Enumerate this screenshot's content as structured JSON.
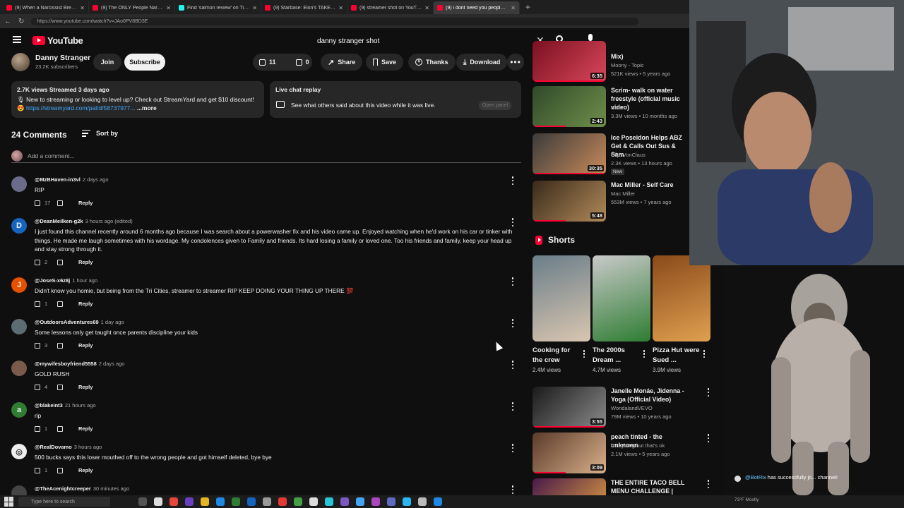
{
  "browser": {
    "tabs": [
      {
        "title": "(9) When a Narcissist Breaks the ...",
        "icon": "youtube-favicon",
        "active": false
      },
      {
        "title": "(9) The ONLY People Narcissists S...",
        "icon": "youtube-favicon",
        "active": false
      },
      {
        "title": "Find 'salmon review' on TikTok | T...",
        "icon": "tiktok-favicon",
        "active": false
      },
      {
        "title": "(9) Starbase: Elon's TAKEOVER of ...",
        "icon": "youtube-favicon",
        "active": false
      },
      {
        "title": "(9) streamer shot on YouTube live...",
        "icon": "youtube-favicon",
        "active": false
      },
      {
        "title": "(9) i dont need you people here, u...",
        "icon": "youtube-favicon",
        "active": true
      }
    ],
    "url": "https://www.youtube.com/watch?v=JAo0PV8BD3E"
  },
  "header": {
    "logo_text": "YouTube",
    "search_value": "danny stranger shot"
  },
  "video": {
    "channel_name": "Danny Stranger",
    "subscribers": "23.2K subscribers",
    "join_label": "Join",
    "subscribe_label": "Subscribe",
    "likes": "11",
    "dislikes": "0",
    "share_label": "Share",
    "save_label": "Save",
    "thanks_label": "Thanks",
    "download_label": "Download"
  },
  "description": {
    "stats": "2.7K views  Streamed 3 days ago",
    "text": "🎙 New to streaming or looking to level up? Check out StreamYard and get $10 discount! 😍 ",
    "link": "https://streamyard.com/pal/d/58737977...",
    "more": " ...more"
  },
  "live_chat": {
    "title": "Live chat replay",
    "subtitle": "See what others said about this video while it was live.",
    "open_label": "Open panel"
  },
  "comments": {
    "count_label": "24 Comments",
    "sort_label": "Sort by",
    "add_placeholder": "Add a comment...",
    "reply_label": "Reply",
    "items": [
      {
        "handle": "@MzBHaven-in3vl",
        "time": "2 days ago",
        "text": "RIP",
        "likes": "17",
        "avatar_letter": "",
        "avatar_color": "#6b6b8a"
      },
      {
        "handle": "@DeanMeilken-g2k",
        "time": "3 hours ago (edited)",
        "text": "I just found this channel recently around 6 months ago because I was search about a powerwasher fix and his video came up.  Enjoyed watching when he'd work on his car or tinker with things. He made me laugh sometimes with his wordage. My condolences given to Family and friends. Its hard losing a family or loved one. Too his friends and family, keep your head up and stay strong through it.",
        "likes": "2",
        "avatar_letter": "D",
        "avatar_color": "#1565c0"
      },
      {
        "handle": "@JoseS-x6z8j",
        "time": "1 hour ago",
        "text": "Didn't know you homie, but being from the Tri Cities,  streamer to streamer RIP KEEP DOING YOUR THING UP THERE 💯",
        "likes": "1",
        "avatar_letter": "J",
        "avatar_color": "#e65100"
      },
      {
        "handle": "@OutdoorsAdventures69",
        "time": "1 day ago",
        "text": "Some lessons only get taught once parents discipline your kids",
        "likes": "3",
        "avatar_letter": "",
        "avatar_color": "#5d6b73"
      },
      {
        "handle": "@mywifesboyfriend5558",
        "time": "2 days ago",
        "text": "GOLD RUSH",
        "likes": "4",
        "avatar_letter": "",
        "avatar_color": "#7a5a4a"
      },
      {
        "handle": "@blakeint3",
        "time": "21 hours ago",
        "text": "rip",
        "likes": "1",
        "avatar_letter": "a",
        "avatar_color": "#2e7d32"
      },
      {
        "handle": "@RealDovamo",
        "time": "3 hours ago",
        "text": "500 bucks says this loser mouthed off to the wrong people and got himself deleted, bye bye",
        "likes": "1",
        "avatar_letter": "◎",
        "avatar_color": "#eeeeee"
      },
      {
        "handle": "@TheAcenightcreeper",
        "time": "30 minutes ago",
        "text": "",
        "likes": "",
        "avatar_letter": "",
        "avatar_color": "#444444"
      }
    ]
  },
  "recommended": [
    {
      "title": "Mix)",
      "channel": "Moony - Topic",
      "meta": "521K views • 5 years ago",
      "duration": "6:35",
      "new": "",
      "colors": [
        "#7a1020",
        "#d9475a"
      ]
    },
    {
      "title": "Scrim- walk on water freestyle (official music video)",
      "channel": "Scrim",
      "meta": "3.3M views • 10 months ago",
      "duration": "2:43",
      "new": "",
      "colors": [
        "#2f4a2a",
        "#6f8f4a"
      ]
    },
    {
      "title": "Ice Poseidon Helps ABZ Get & Calls Out Sus & Sam",
      "channel": "ClipsVonClaus",
      "meta": "2.3K views • 13 hours ago",
      "duration": "30:35",
      "new": "New",
      "colors": [
        "#3b3b3b",
        "#c88a5a"
      ]
    },
    {
      "title": "Mac Miller - Self Care",
      "channel": "Mac Miller",
      "meta": "553M views • 7 years ago",
      "duration": "5:48",
      "new": "",
      "colors": [
        "#3a2a1a",
        "#b08a5a"
      ]
    },
    {
      "title": "Janelle Monáe, Jidenna - Yoga (Official Video)",
      "channel": "WondalandVEVO",
      "meta": "79M views • 10 years ago",
      "duration": "3:55",
      "new": "",
      "colors": [
        "#1a1a1a",
        "#8a8a8a"
      ]
    },
    {
      "title": "peach tinted - the unknown",
      "channel": "i'm cyborg but that's ok",
      "meta": "2.1M views • 5 years ago",
      "duration": "3:09",
      "new": "",
      "colors": [
        "#5a3a2a",
        "#d9b08a"
      ]
    },
    {
      "title": "THE ENTIRE TACO BELL MENU CHALLENGE | BeardMeatsFood",
      "channel": "",
      "meta": "",
      "duration": "",
      "new": "",
      "colors": [
        "#4a1a4a",
        "#e0a040"
      ]
    }
  ],
  "shorts": {
    "title": "Shorts",
    "items": [
      {
        "title": "Cooking for the crew",
        "views": "2.4M views",
        "colors": [
          "#6a7e8a",
          "#d9c6b0"
        ]
      },
      {
        "title": "The 2000s Dream ...",
        "views": "4.7M views",
        "colors": [
          "#c9c9c9",
          "#2e7d32"
        ]
      },
      {
        "title": "Pizza Hut were Sued ...",
        "views": "3.9M views",
        "colors": [
          "#8a4a1a",
          "#e0a050"
        ]
      }
    ]
  },
  "overlay": {
    "bot_user": "@BotRix",
    "bot_text": " has successfully jo... channel!"
  },
  "taskbar": {
    "search_placeholder": "Type here to search",
    "tray": "73°F  Mostly"
  }
}
